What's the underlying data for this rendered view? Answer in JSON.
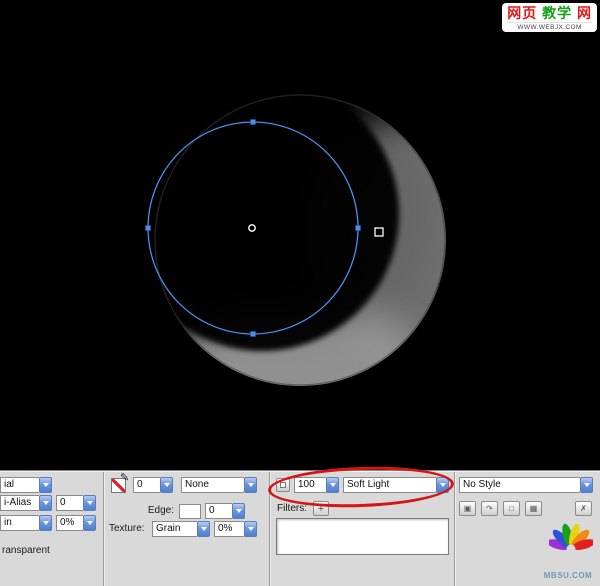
{
  "colors": {
    "canvas_bg": "#000000",
    "panel_bg": "#d9d9d9",
    "selection_blue": "#4a8fe8",
    "annotation_red": "#d41616"
  },
  "watermark_top": {
    "parts": [
      {
        "text": "网页",
        "color": "#e01818"
      },
      {
        "text": "教学",
        "color": "#18a018"
      },
      {
        "text": "网",
        "color": "#e01818"
      }
    ],
    "url": "WWW.WEBJX.COM"
  },
  "inspector": {
    "fill": {
      "type_value": "ial",
      "edge_value": "i-Alias",
      "edge_amount": "0",
      "texture_value": "in",
      "texture_amount": "0%",
      "transparent_label": "ransparent"
    },
    "stroke": {
      "tip_size": "0",
      "category": "None",
      "edge_label": "Edge:",
      "edge_amount": "0",
      "texture_label": "Texture:",
      "texture_value": "Grain",
      "texture_amount": "0%"
    },
    "blend": {
      "opacity": "100",
      "mode": "Soft Light",
      "filters_label": "Filters:"
    },
    "style": {
      "value": "No Style"
    },
    "icons": {
      "pencil": "✎",
      "plus": "+",
      "style_buttons": [
        "▣",
        "↷",
        "□",
        "▦",
        "✗"
      ]
    }
  },
  "watermark_bottom": {
    "text": "MBSU.COM"
  }
}
